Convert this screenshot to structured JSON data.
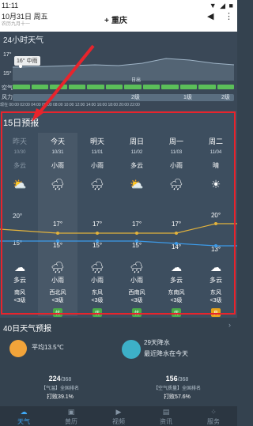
{
  "status": {
    "time": "11:11",
    "icons": "▼ ◢ ■"
  },
  "header": {
    "date": "10月31日 周五",
    "lunar": "农历九月十一",
    "city": "重庆",
    "plus": "+"
  },
  "h24": {
    "title": "24小时天气",
    "ticks": [
      "17°",
      "15°"
    ],
    "tag": "16° 中雨",
    "rows": [
      "空气",
      "风力"
    ],
    "sunset": "日出",
    "wind_levels": [
      "2级",
      "1级",
      "2级"
    ],
    "hours": "现在  00:00  02:00  04:00  06:00  08:00  10:00  12:00  14:00  16:00  18:00  20:00  22:00"
  },
  "d15": {
    "title": "15日预报",
    "days": [
      {
        "wk": "昨天",
        "date": "10/30",
        "day_cond": "多云",
        "high": "",
        "low": "",
        "night_cond": "多云",
        "wind_dir": "南风",
        "wind_lv": "<3级",
        "aq": ""
      },
      {
        "wk": "今天",
        "date": "10/31",
        "day_cond": "小雨",
        "high": "17°",
        "low": "15°",
        "night_cond": "小雨",
        "wind_dir": "西北风",
        "wind_lv": "<3级",
        "aq": "优"
      },
      {
        "wk": "明天",
        "date": "11/01",
        "day_cond": "小雨",
        "high": "17°",
        "low": "15°",
        "night_cond": "小雨",
        "wind_dir": "东风",
        "wind_lv": "<3级",
        "aq": "优"
      },
      {
        "wk": "周日",
        "date": "11/02",
        "day_cond": "多云",
        "high": "17°",
        "low": "15°",
        "night_cond": "小雨",
        "wind_dir": "西南风",
        "wind_lv": "<3级",
        "aq": "优"
      },
      {
        "wk": "周一",
        "date": "11/03",
        "day_cond": "小雨",
        "high": "17°",
        "low": "14°",
        "night_cond": "多云",
        "wind_dir": "东南风",
        "wind_lv": "<3级",
        "aq": "优"
      },
      {
        "wk": "周二",
        "date": "11/04",
        "day_cond": "晴",
        "high": "20°",
        "low": "13°",
        "night_cond": "多云",
        "wind_dir": "东风",
        "wind_lv": "<3级",
        "aq": "良"
      }
    ],
    "axis": [
      "20°",
      "15°"
    ]
  },
  "d40": {
    "title": "40日天气预报",
    "more": "›",
    "avg_temp": "平均13.5℃",
    "rain_title": "29天降水",
    "rain_sub": "最近降水在今天",
    "rank_temp": {
      "n": "224",
      "total": "/368",
      "label": "【气温】全国排名",
      "beat": "打败39.1%"
    },
    "rank_air": {
      "n": "156",
      "total": "/368",
      "label": "【空气质量】全国排名",
      "beat": "打败57.6%"
    }
  },
  "nav": [
    "天气",
    "黄历",
    "视频",
    "资讯",
    "服务"
  ],
  "colors": {
    "accent": "#3fa8f5",
    "highlight": "#e8242c",
    "good": "#4aab4a",
    "fair": "#e5a21b"
  }
}
